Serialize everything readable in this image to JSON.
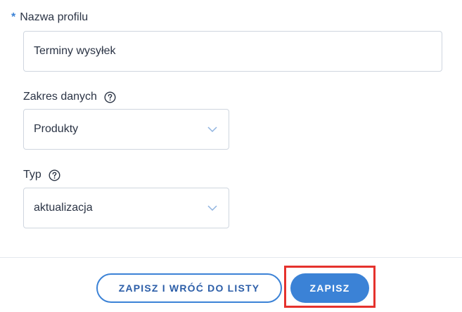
{
  "form": {
    "profile_name": {
      "required_mark": "*",
      "label": "Nazwa profilu",
      "value": "Terminy wysyłek"
    },
    "data_scope": {
      "label": "Zakres danych",
      "help_icon": "question-circle-icon",
      "selected": "Produkty"
    },
    "type": {
      "label": "Typ",
      "help_icon": "question-circle-icon",
      "selected": "aktualizacja"
    }
  },
  "footer": {
    "save_and_back_label": "ZAPISZ I WRÓĆ DO LISTY",
    "save_label": "ZAPISZ"
  },
  "colors": {
    "accent": "#3b82d6",
    "highlight": "#e5322d"
  }
}
